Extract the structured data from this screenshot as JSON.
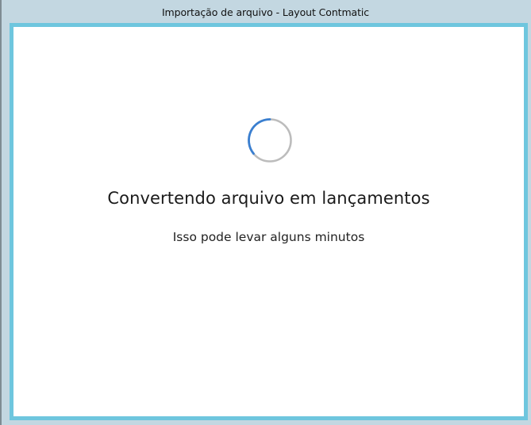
{
  "window": {
    "title": "Importação de arquivo - Layout Contmatic"
  },
  "loading": {
    "spinner_icon": "loading-spinner-icon",
    "headline": "Convertendo arquivo em lançamentos",
    "subline": "Isso pode levar alguns minutos"
  },
  "colors": {
    "frame": "#6ec6de",
    "titlebar": "#c3d7e1",
    "spinner_active": "#3a7fd0",
    "spinner_track": "#b8b8b8"
  }
}
